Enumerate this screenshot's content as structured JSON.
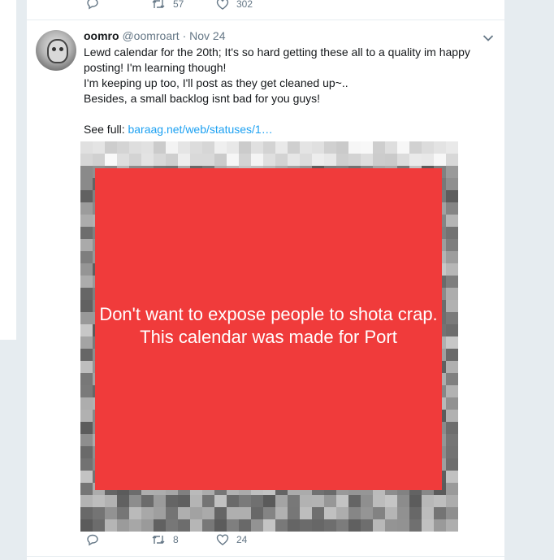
{
  "previous_tweet": {
    "retweets": "57",
    "likes": "302"
  },
  "tweet": {
    "display_name": "oomro",
    "handle": "@oomroart",
    "separator": "·",
    "date": "Nov 24",
    "lines": [
      "Lewd calendar for the 20th; It's so hard getting these all to a quality im happy posting! I'm learning though!",
      "I'm keeping up too, I'll post as they get cleaned up~..",
      "Besides, a small backlog isnt bad for you guys!"
    ],
    "see_full_label": "See full:",
    "link_text": "baraag.net/web/statuses/1…",
    "overlay_text": "Don't want to expose people to shota crap.\nThis calendar was made for Port",
    "replies": "",
    "retweets": "8",
    "likes": "24"
  },
  "icons": {
    "reply": "reply-icon",
    "retweet": "retweet-icon",
    "like": "heart-icon",
    "menu": "chevron-down-icon"
  },
  "colors": {
    "accent": "#1da1f2",
    "muted": "#657786",
    "overlay": "#f03b3b",
    "background": "#e6ecf0"
  }
}
